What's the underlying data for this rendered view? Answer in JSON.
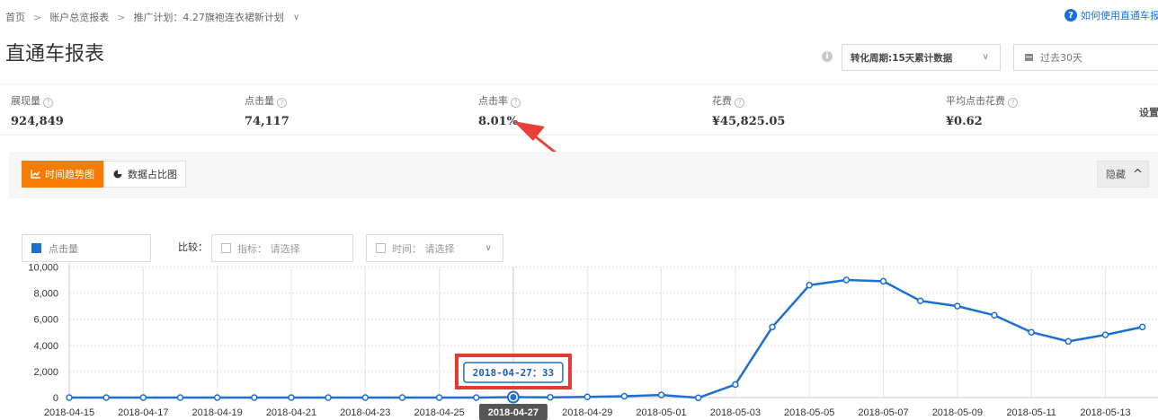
{
  "breadcrumb": {
    "home": "首页",
    "sep": ">",
    "level1": "账户总览报表",
    "level2": "推广计划：4.27旗袍连衣裙新计划",
    "caret": "∨"
  },
  "help": {
    "icon": "?",
    "text": "如何使用直通车报表"
  },
  "page_title": "直通车报表",
  "controls": {
    "info_icon": "i",
    "period": "转化周期:15天累计数据",
    "period_caret": "∨",
    "date_range": "过去30天"
  },
  "metrics": [
    {
      "label": "展现量",
      "value": "924,849"
    },
    {
      "label": "点击量",
      "value": "74,117"
    },
    {
      "label": "点击率",
      "value": "8.01%"
    },
    {
      "label": "花费",
      "value": "¥45,825.05"
    },
    {
      "label": "平均点击花费",
      "value": "¥0.62"
    }
  ],
  "metric_help_glyph": "?",
  "settings_label": "设置",
  "chart_tabs": {
    "time_trend": "时间趋势图",
    "share": "数据占比图"
  },
  "hide_label": "隐藏",
  "hide_caret": "^",
  "filters": {
    "metric": "点击量",
    "compare_label": "比较：",
    "indicator": "指标：  请选择",
    "time": "时间：  请选择",
    "caret": "∨"
  },
  "colors": {
    "accent": "#f57c00",
    "series": "#1f6fcf",
    "annotation_border": "#e53935",
    "arrow": "#e8403a"
  },
  "chart_data": {
    "type": "line",
    "title": "",
    "xlabel": "",
    "ylabel": "",
    "ylim": [
      0,
      10000
    ],
    "yticks": [
      0,
      2000,
      4000,
      6000,
      8000,
      10000
    ],
    "ytick_labels": [
      "0",
      "2,000",
      "4,000",
      "6,000",
      "8,000",
      "10,000"
    ],
    "x": [
      "2018-04-15",
      "2018-04-16",
      "2018-04-17",
      "2018-04-18",
      "2018-04-19",
      "2018-04-20",
      "2018-04-21",
      "2018-04-22",
      "2018-04-23",
      "2018-04-24",
      "2018-04-25",
      "2018-04-26",
      "2018-04-27",
      "2018-04-28",
      "2018-04-29",
      "2018-04-30",
      "2018-05-01",
      "2018-05-02",
      "2018-05-03",
      "2018-05-04",
      "2018-05-05",
      "2018-05-06",
      "2018-05-07",
      "2018-05-08",
      "2018-05-09",
      "2018-05-10",
      "2018-05-11",
      "2018-05-12",
      "2018-05-13",
      "2018-05-14"
    ],
    "xtick_labels": [
      "2018-04-15",
      "2018-04-17",
      "2018-04-19",
      "2018-04-21",
      "2018-04-23",
      "2018-04-25",
      "2018-04-27",
      "2018-04-29",
      "2018-05-01",
      "2018-05-03",
      "2018-05-05",
      "2018-05-07",
      "2018-05-09",
      "2018-05-11",
      "2018-05-13"
    ],
    "series": [
      {
        "values": [
          0,
          0,
          0,
          0,
          0,
          0,
          0,
          0,
          0,
          0,
          0,
          0,
          33,
          20,
          50,
          100,
          200,
          -20,
          1000,
          5400,
          8600,
          9000,
          8900,
          7400,
          7000,
          6300,
          5000,
          4300,
          4800,
          5400
        ]
      }
    ],
    "highlighted_x": "2018-04-27",
    "tooltip": "2018-04-27：33",
    "grid": true
  }
}
